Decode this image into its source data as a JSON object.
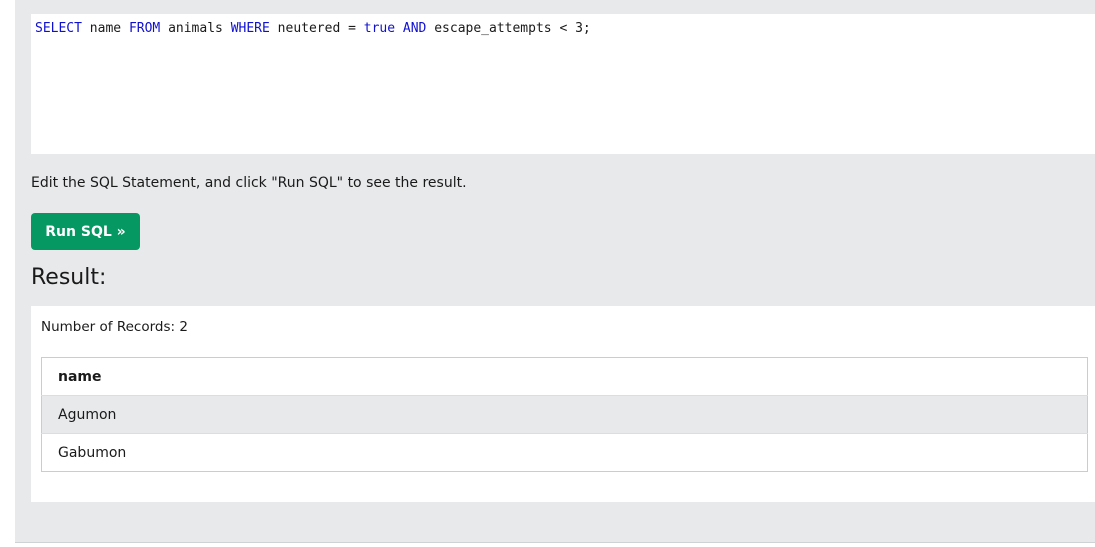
{
  "editor": {
    "tokens": [
      {
        "text": "SELECT",
        "kw": true
      },
      {
        "text": " name ",
        "kw": false
      },
      {
        "text": "FROM",
        "kw": true
      },
      {
        "text": " animals ",
        "kw": false
      },
      {
        "text": "WHERE",
        "kw": true
      },
      {
        "text": " neutered = ",
        "kw": false
      },
      {
        "text": "true",
        "kw": true
      },
      {
        "text": " ",
        "kw": false
      },
      {
        "text": "AND",
        "kw": true
      },
      {
        "text": " escape_attempts < 3;",
        "kw": false
      }
    ]
  },
  "instructions": "Edit the SQL Statement, and click \"Run SQL\" to see the result.",
  "run_button_label": "Run SQL »",
  "result": {
    "heading": "Result:",
    "record_count": "Number of Records: 2",
    "columns": [
      "name"
    ],
    "rows": [
      [
        "Agumon"
      ],
      [
        "Gabumon"
      ]
    ]
  },
  "colors": {
    "panel_bg": "#e7e9eb",
    "button_bg": "#059862",
    "keyword": "#1010d0"
  }
}
